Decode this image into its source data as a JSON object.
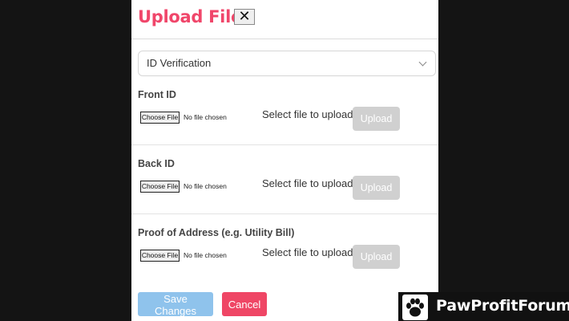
{
  "modal": {
    "title": "Upload File",
    "close_label": "✕",
    "document_type": {
      "selected": "ID Verification"
    },
    "sections": [
      {
        "label": "Front ID",
        "file_button_label": "Choose File",
        "file_status": "No file chosen",
        "hint": "Select file to upload...",
        "upload_label": "Upload"
      },
      {
        "label": "Back ID",
        "file_button_label": "Choose File",
        "file_status": "No file chosen",
        "hint": "Select file to upload...",
        "upload_label": "Upload"
      },
      {
        "label": "Proof of Address (e.g. Utility Bill)",
        "file_button_label": "Choose File",
        "file_status": "No file chosen",
        "hint": "Select file to upload...",
        "upload_label": "Upload"
      }
    ],
    "footer": {
      "save_label": "Save Changes",
      "cancel_label": "Cancel"
    }
  },
  "watermark": {
    "text": "PawProfitForum",
    "icon": "paw-icon"
  },
  "colors": {
    "title": "#f0466a",
    "save": "#8fc3ec",
    "cancel": "#ef4665",
    "upload_disabled": "#d0d0d0",
    "backdrop": "#141414"
  }
}
